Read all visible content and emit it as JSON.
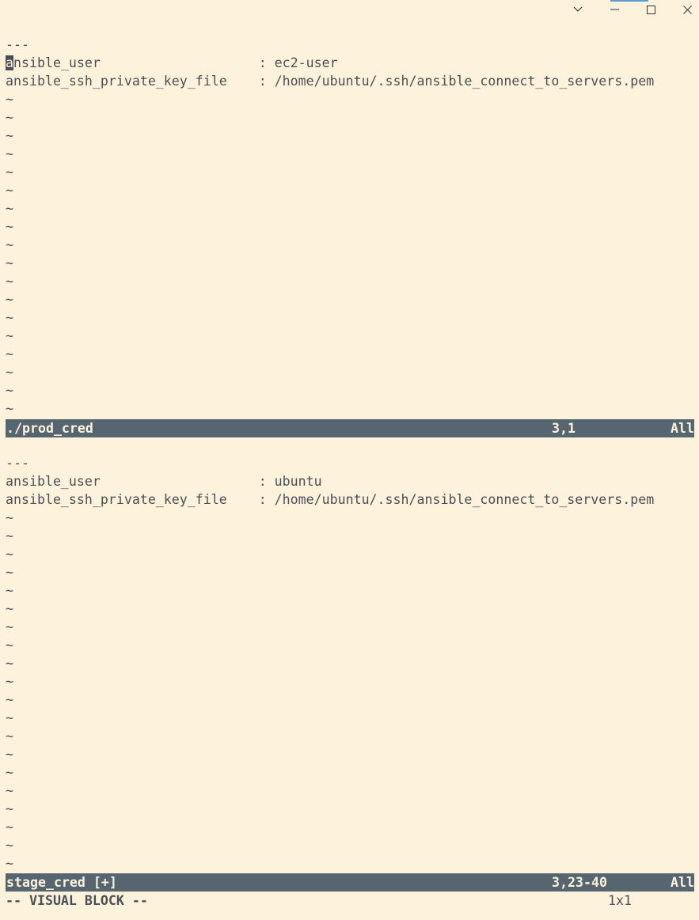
{
  "window": {
    "controls": [
      "chevron-down",
      "minimize",
      "maximize",
      "close"
    ]
  },
  "top_pane": {
    "lines": [
      "---",
      "ansible_user                    : ec2-user",
      "ansible_ssh_private_key_file    : /home/ubuntu/.ssh/ansible_connect_to_servers.pem"
    ],
    "cursor_char": "a",
    "line1_rest": "nsible_user                    : ec2-user",
    "tilde_count": 18,
    "status": {
      "filename": "./prod_cred",
      "position": "3,1",
      "scroll": "All"
    }
  },
  "bottom_pane": {
    "lines": [
      "---",
      "ansible_user                    : ubuntu",
      "ansible_ssh_private_key_file    : /home/ubuntu/.ssh/ansible_connect_to_servers.pem"
    ],
    "tilde_count": 20,
    "status": {
      "filename": "stage_cred [+]",
      "position": "3,23-40",
      "scroll": "All"
    }
  },
  "mode": {
    "label": "-- VISUAL BLOCK --",
    "selection_size": "1x1"
  },
  "colors": {
    "background": "#fdf3dd",
    "text": "#4a4f55",
    "statusbar": "#56656f",
    "accent": "#5b9bd5"
  }
}
